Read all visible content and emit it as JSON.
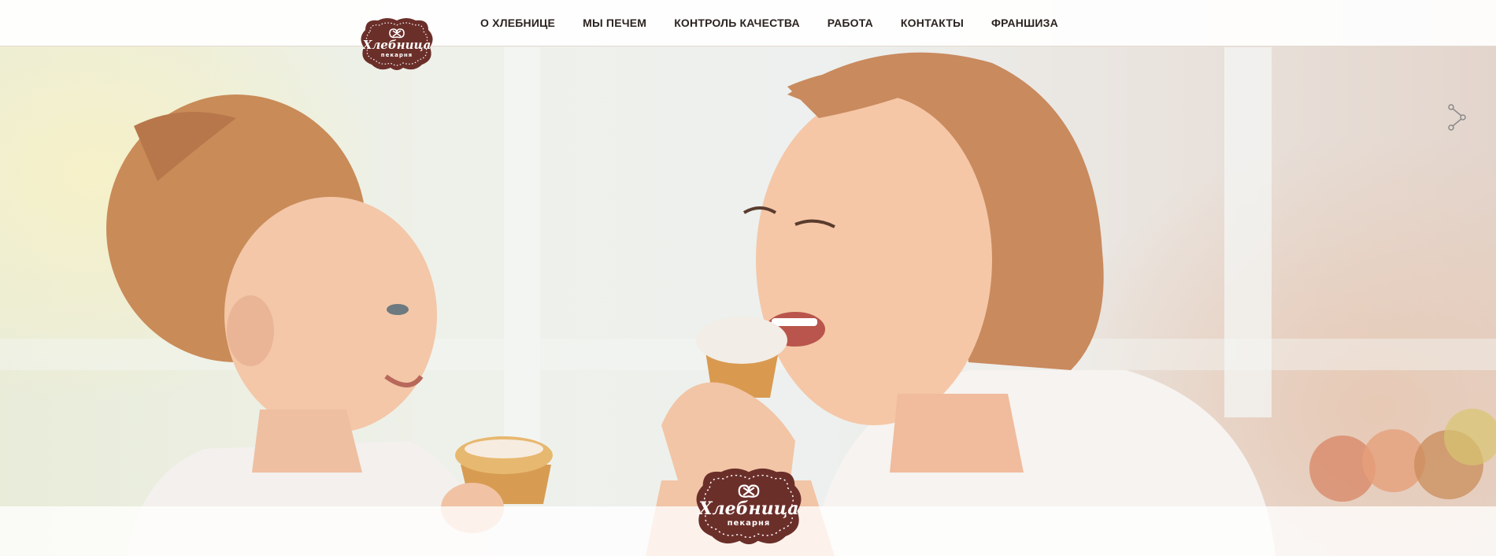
{
  "brand": {
    "name": "Хлебница",
    "subtitle": "пекарня",
    "primary_color": "#6b2f2a",
    "dot_color": "#ffffff"
  },
  "nav": {
    "items": [
      {
        "label": "О ХЛЕБНИЦЕ"
      },
      {
        "label": "МЫ ПЕЧЕМ"
      },
      {
        "label": "КОНТРОЛЬ КАЧЕСТВА"
      },
      {
        "label": "РАБОТА"
      },
      {
        "label": "КОНТАКТЫ"
      },
      {
        "label": "ФРАНШИЗА"
      }
    ]
  },
  "hero": {
    "image": "photo of a mother and daughter smiling and eating muffins"
  },
  "icons": {
    "share": "share-icon",
    "pretzel": "pretzel-icon"
  }
}
